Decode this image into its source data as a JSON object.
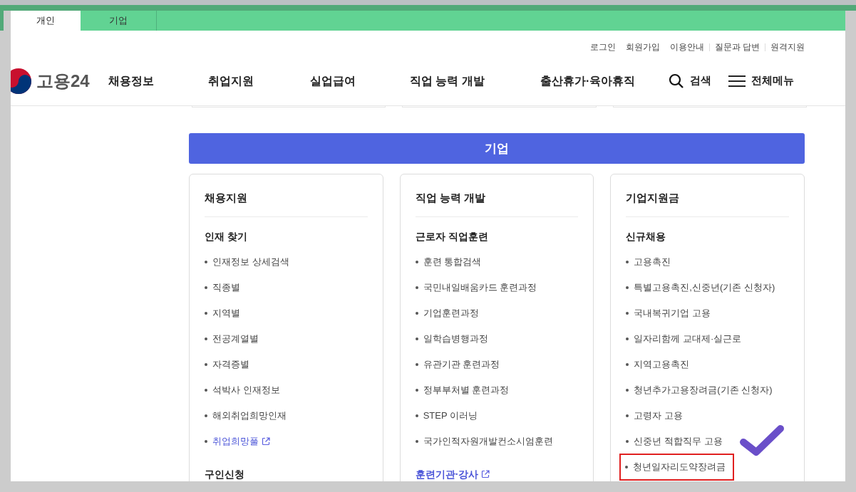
{
  "tabs": [
    {
      "label": "개인",
      "selected": true
    },
    {
      "label": "기업",
      "selected": false
    }
  ],
  "utility_links": [
    {
      "label": "로그인",
      "divider_before": false
    },
    {
      "label": "회원가입",
      "divider_before": false
    },
    {
      "label": "이용안내",
      "divider_before": false
    },
    {
      "label": "질문과 답변",
      "divider_before": true
    },
    {
      "label": "원격지원",
      "divider_before": true
    }
  ],
  "logo": {
    "text": "고용24"
  },
  "nav": [
    "채용정보",
    "취업지원",
    "실업급여",
    "직업 능력 개발",
    "출산휴가·육아휴직"
  ],
  "search": {
    "label": "검색"
  },
  "menu": {
    "label": "전체메뉴"
  },
  "banner": {
    "title": "기업"
  },
  "cards": [
    {
      "title": "채용지원",
      "entries": [
        {
          "kind": "heading",
          "text": "인재 찾기"
        },
        {
          "kind": "item",
          "text": "인재정보 상세검색",
          "highlighted": false
        },
        {
          "kind": "item",
          "text": "직종별",
          "highlighted": false
        },
        {
          "kind": "item",
          "text": "지역별",
          "highlighted": false
        },
        {
          "kind": "item",
          "text": "전공계열별",
          "highlighted": false
        },
        {
          "kind": "item",
          "text": "자격증별",
          "highlighted": false
        },
        {
          "kind": "item",
          "text": "석박사 인재정보",
          "highlighted": false
        },
        {
          "kind": "item",
          "text": "해외취업희망인재",
          "highlighted": false
        },
        {
          "kind": "link_item",
          "text": "취업희망풀"
        },
        {
          "kind": "heading",
          "text": "구인신청"
        }
      ]
    },
    {
      "title": "직업 능력 개발",
      "entries": [
        {
          "kind": "heading",
          "text": "근로자 직업훈련"
        },
        {
          "kind": "item",
          "text": "훈련 통합검색",
          "highlighted": false
        },
        {
          "kind": "item",
          "text": "국민내일배움카드 훈련과정",
          "highlighted": false
        },
        {
          "kind": "item",
          "text": "기업훈련과정",
          "highlighted": false
        },
        {
          "kind": "item",
          "text": "일학습병행과정",
          "highlighted": false
        },
        {
          "kind": "item",
          "text": "유관기관 훈련과정",
          "highlighted": false
        },
        {
          "kind": "item",
          "text": "정부부처별 훈련과정",
          "highlighted": false
        },
        {
          "kind": "item",
          "text": "STEP 이러닝",
          "highlighted": false
        },
        {
          "kind": "item",
          "text": "국가인적자원개발컨소시엄훈련",
          "highlighted": false
        },
        {
          "kind": "heading_link",
          "text": "훈련기관·강사"
        }
      ]
    },
    {
      "title": "기업지원금",
      "entries": [
        {
          "kind": "heading",
          "text": "신규채용"
        },
        {
          "kind": "item",
          "text": "고용촉진",
          "highlighted": false
        },
        {
          "kind": "item",
          "text": "특별고용촉진,신중년(기존 신청자)",
          "highlighted": false
        },
        {
          "kind": "item",
          "text": "국내복귀기업 고용",
          "highlighted": false
        },
        {
          "kind": "item",
          "text": "일자리함께 교대제·실근로",
          "highlighted": false
        },
        {
          "kind": "item",
          "text": "지역고용촉진",
          "highlighted": false
        },
        {
          "kind": "item",
          "text": "청년추가고용장려금(기존 신청자)",
          "highlighted": false
        },
        {
          "kind": "item",
          "text": "고령자 고용",
          "highlighted": false
        },
        {
          "kind": "item",
          "text": "신중년 적합직무 고용",
          "highlighted": false
        },
        {
          "kind": "item",
          "text": "청년일자리도약장려금",
          "highlighted": true
        }
      ]
    }
  ]
}
